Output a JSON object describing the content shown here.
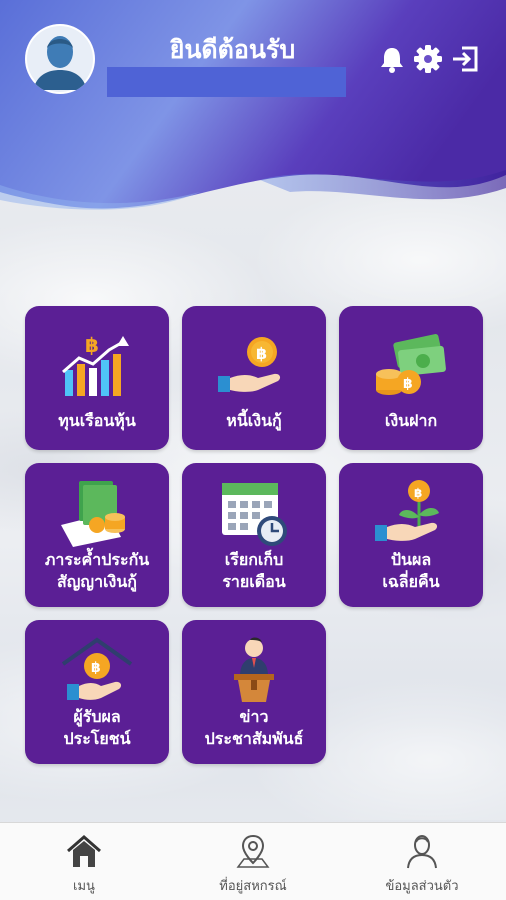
{
  "header": {
    "welcome_text": "ยินดีต้อนรับ",
    "user_name": "",
    "icons": [
      "bell-icon",
      "gear-icon",
      "logout-icon"
    ]
  },
  "menu": {
    "tiles": [
      {
        "label_1": "ทุนเรือนหุ้น",
        "label_2": "",
        "icon": "stock-chart-icon"
      },
      {
        "label_1": "หนี้เงินกู้",
        "label_2": "",
        "icon": "loan-coin-hand-icon"
      },
      {
        "label_1": "เงินฝาก",
        "label_2": "",
        "icon": "deposit-money-icon"
      },
      {
        "label_1": "ภาระค้ำประกัน",
        "label_2": "สัญญาเงินกู้",
        "icon": "guarantee-money-icon"
      },
      {
        "label_1": "เรียกเก็บ",
        "label_2": "รายเดือน",
        "icon": "calendar-clock-icon"
      },
      {
        "label_1": "ปันผล",
        "label_2": "เฉลี่ยคืน",
        "icon": "dividend-plant-icon"
      },
      {
        "label_1": "ผู้รับผล",
        "label_2": "ประโยชน์",
        "icon": "beneficiary-house-icon"
      },
      {
        "label_1": "ข่าว",
        "label_2": "ประชาสัมพันธ์",
        "icon": "news-speaker-icon"
      }
    ]
  },
  "bottom_nav": {
    "items": [
      {
        "label": "เมนู",
        "icon": "home-icon"
      },
      {
        "label": "ที่อยู่สหกรณ์",
        "icon": "map-pin-icon"
      },
      {
        "label": "ข้อมูลส่วนตัว",
        "icon": "profile-icon"
      }
    ]
  },
  "colors": {
    "tile_bg": "#5b1f95",
    "header_gradient_start": "#3a7fd9",
    "header_gradient_end": "#5a2aa8",
    "accent_gold": "#f5a623"
  }
}
